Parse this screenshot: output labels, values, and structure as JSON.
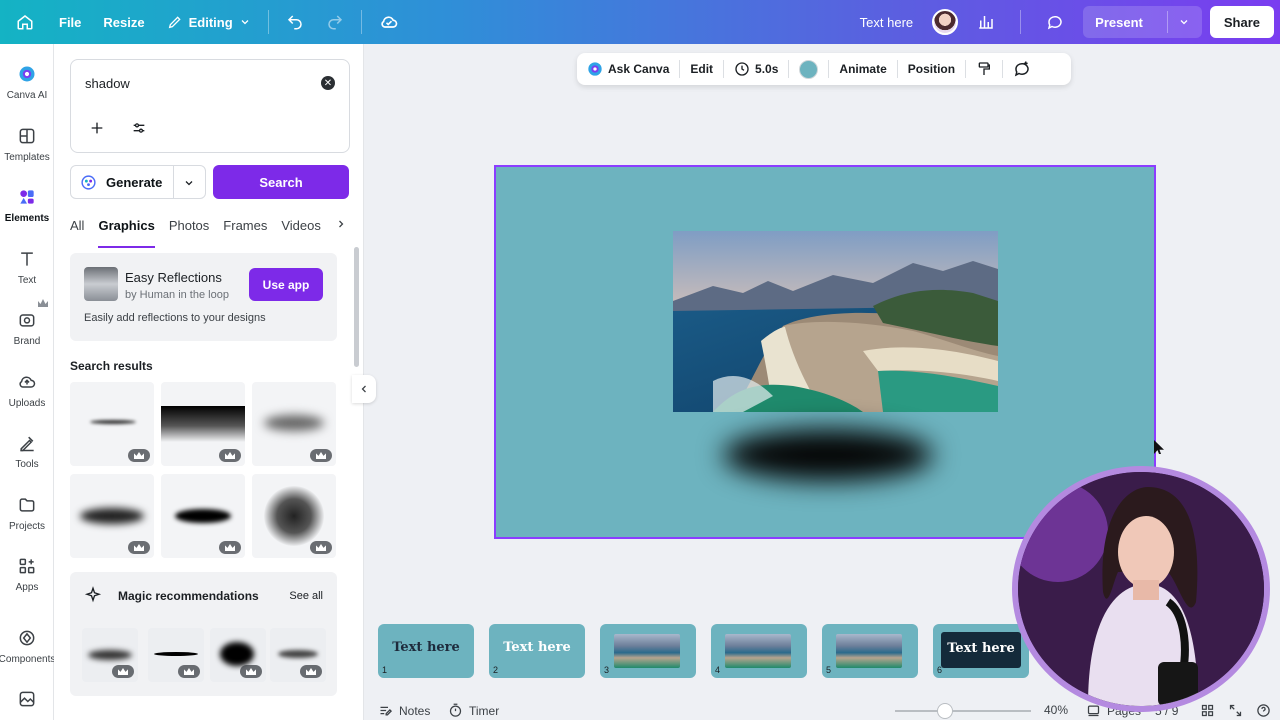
{
  "topbar": {
    "file": "File",
    "resize": "Resize",
    "editing": "Editing",
    "text_here": "Text here",
    "present": "Present",
    "share": "Share",
    "gradient_start": "#14b3c4",
    "gradient_end": "#7a3df0"
  },
  "rail": {
    "items": [
      {
        "label": "Canva AI",
        "icon": "canva-ai-icon"
      },
      {
        "label": "Templates",
        "icon": "templates-icon"
      },
      {
        "label": "Elements",
        "icon": "elements-icon"
      },
      {
        "label": "Text",
        "icon": "text-icon"
      },
      {
        "label": "Brand",
        "icon": "brand-icon"
      },
      {
        "label": "Uploads",
        "icon": "uploads-icon"
      },
      {
        "label": "Tools",
        "icon": "tools-icon"
      },
      {
        "label": "Projects",
        "icon": "projects-icon"
      },
      {
        "label": "Apps",
        "icon": "apps-icon"
      },
      {
        "label": "Components",
        "icon": "components-icon"
      }
    ]
  },
  "panel": {
    "search_value": "shadow",
    "generate_label": "Generate",
    "search_label": "Search",
    "tabs": [
      "All",
      "Graphics",
      "Photos",
      "Frames",
      "Videos"
    ],
    "active_tab": "Graphics",
    "app_card": {
      "title": "Easy Reflections",
      "by": "by Human in the loop",
      "use_app": "Use app",
      "description": "Easily add reflections to your designs"
    },
    "results_title": "Search results",
    "magic": {
      "title": "Magic recommendations",
      "see_all": "See all"
    }
  },
  "context_toolbar": {
    "ask_canva": "Ask Canva",
    "edit": "Edit",
    "duration": "5.0s",
    "color": "#6db3bf",
    "animate": "Animate",
    "position": "Position"
  },
  "canvas": {
    "background": "#6db3bf",
    "selection_color": "#8b3dff"
  },
  "pages": [
    {
      "num": "1",
      "text": "Text here",
      "kind": "text"
    },
    {
      "num": "2",
      "text": "Text here",
      "kind": "text-light"
    },
    {
      "num": "3",
      "text": "",
      "kind": "photo"
    },
    {
      "num": "4",
      "text": "",
      "kind": "photo"
    },
    {
      "num": "5",
      "text": "",
      "kind": "photo"
    },
    {
      "num": "6",
      "text": "Text here",
      "kind": "dark"
    }
  ],
  "bottombar": {
    "notes": "Notes",
    "timer": "Timer",
    "zoom": "40%",
    "pages_label": "Pages",
    "page_count": "5 / 9"
  },
  "accent_color": "#7d2ae8"
}
